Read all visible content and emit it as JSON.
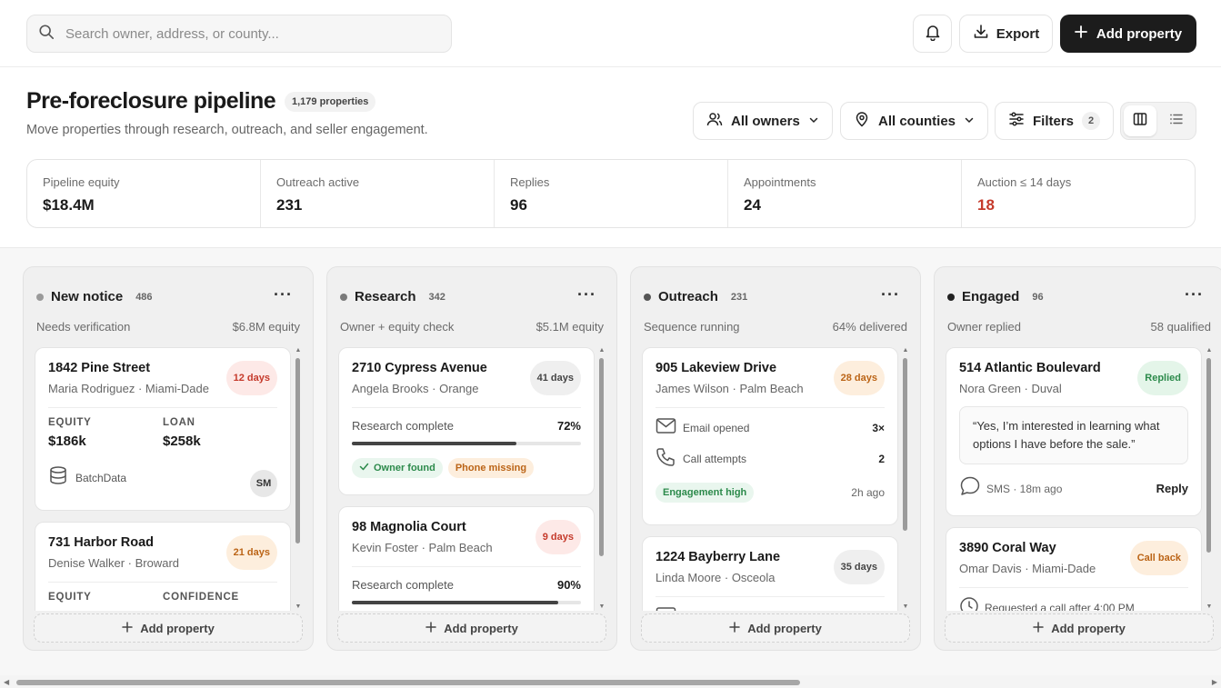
{
  "search": {
    "placeholder": "Search owner, address, or county..."
  },
  "toolbar": {
    "export_label": "Export",
    "add_label": "Add property"
  },
  "header": {
    "title": "Pre-foreclosure pipeline",
    "count": "1,179 properties",
    "subtitle": "Move properties through research, outreach, and seller engagement.",
    "owners_filter": "All owners",
    "counties_filter": "All counties",
    "filters_label": "Filters",
    "filters_count": "2"
  },
  "stats": [
    {
      "label": "Pipeline equity",
      "value": "$18.4M"
    },
    {
      "label": "Outreach active",
      "value": "231"
    },
    {
      "label": "Replies",
      "value": "96"
    },
    {
      "label": "Appointments",
      "value": "24"
    },
    {
      "label": "Auction ≤ 14 days",
      "value": "18"
    }
  ],
  "colors": {
    "accent": "#1c1c1c",
    "danger": "#c53a2b",
    "success": "#2c8a4b",
    "warning": "#bb6416"
  },
  "columns": [
    {
      "title": "New notice",
      "count": "486",
      "sub": "Needs verification",
      "sub_right": "$6.8M equity",
      "add_label": "Add property",
      "cards": [
        {
          "title": "1842 Pine Street",
          "sub": "Maria Rodriguez · Miami-Dade",
          "days": "12 days",
          "k1": "EQUITY",
          "v1": "$186k",
          "k2": "LOAN",
          "v2": "$258k",
          "source": "BatchData",
          "avatar": "SM"
        },
        {
          "title": "731 Harbor Road",
          "sub": "Denise Walker · Broward",
          "days": "21 days",
          "k1": "EQUITY",
          "k2": "CONFIDENCE"
        }
      ]
    },
    {
      "title": "Research",
      "count": "342",
      "sub": "Owner + equity check",
      "sub_right": "$5.1M equity",
      "add_label": "Add property",
      "cards": [
        {
          "title": "2710 Cypress Avenue",
          "sub": "Angela Brooks · Orange",
          "days": "41 days",
          "progress_label": "Research complete",
          "progress_value": "72%",
          "progress": 0.72,
          "chip1": "Owner found",
          "chip2": "Phone missing"
        },
        {
          "title": "98 Magnolia Court",
          "sub": "Kevin Foster · Palm Beach",
          "days": "9 days",
          "progress_label": "Research complete",
          "progress_value": "90%",
          "progress": 0.9
        }
      ]
    },
    {
      "title": "Outreach",
      "count": "231",
      "sub": "Sequence running",
      "sub_right": "64% delivered",
      "add_label": "Add property",
      "cards": [
        {
          "title": "905 Lakeview Drive",
          "sub": "James Wilson · Palm Beach",
          "days": "28 days",
          "a1": "Email opened",
          "a1v": "3×",
          "a2": "Call attempts",
          "a2v": "2",
          "chip": "Engagement high",
          "time": "2h ago"
        },
        {
          "title": "1224 Bayberry Lane",
          "sub": "Linda Moore · Osceola",
          "days": "35 days"
        }
      ]
    },
    {
      "title": "Engaged",
      "count": "96",
      "sub": "Owner replied",
      "sub_right": "58 qualified",
      "add_label": "Add property",
      "cards": [
        {
          "title": "514 Atlantic Boulevard",
          "sub": "Nora Green · Duval",
          "days": "Replied",
          "quote": "“Yes, I’m interested in learning what options I have before the sale.”",
          "sms": "SMS · 18m ago",
          "reply": "Reply"
        },
        {
          "title": "3890 Coral Way",
          "sub": "Omar Davis · Miami-Dade",
          "days": "Call back",
          "note": "Requested a call after 4:00 PM"
        }
      ]
    }
  ]
}
